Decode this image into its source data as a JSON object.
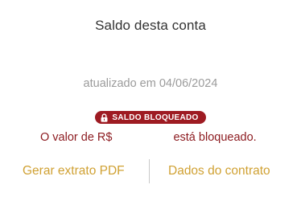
{
  "account": {
    "title": "Saldo desta conta",
    "updated": "atualizado em 04/06/2024"
  },
  "status": {
    "badge_label": "SALDO BLOQUEADO",
    "badge_icon": "lock-icon",
    "message_prefix": "O valor de R$",
    "message_suffix": "está bloqueado."
  },
  "actions": {
    "statement_label": "Gerar extrato PDF",
    "contract_label": "Dados do contrato"
  },
  "colors": {
    "badge_bg": "#9e1b22",
    "alert_text": "#8c1a1f",
    "link": "#d0a133"
  }
}
